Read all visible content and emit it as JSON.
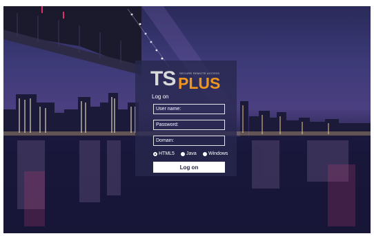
{
  "logo": {
    "primary": "TS",
    "secondary": "PLUS",
    "tagline": "SECURE REMOTE ACCESS"
  },
  "login": {
    "title": "Log on",
    "username_placeholder": "User name:",
    "password_placeholder": "Password:",
    "domain_placeholder": "Domain:",
    "options": [
      {
        "label": "HTML5",
        "selected": true
      },
      {
        "label": "Java",
        "selected": false
      },
      {
        "label": "Windows",
        "selected": false
      }
    ],
    "submit_label": "Log on"
  },
  "colors": {
    "accent": "#f0961e",
    "panel": "#28284e",
    "sky": "#3d3a78"
  }
}
